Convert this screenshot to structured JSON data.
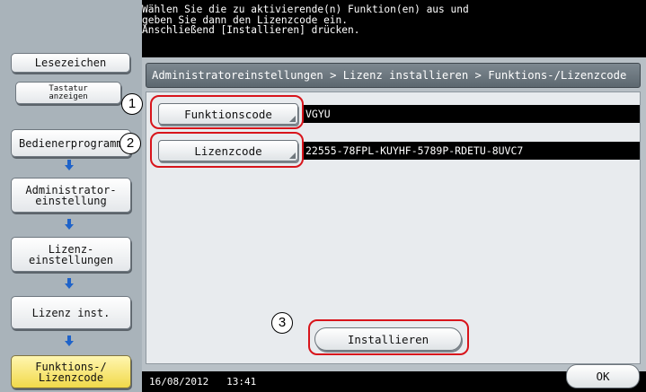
{
  "header": {
    "instruction": "Wählen Sie die zu aktivierende(n) Funktion(en) aus und\ngeben Sie dann den Lizenzcode ein.\nAnschließend [Installieren] drücken."
  },
  "sidebar": {
    "bookmark_label": "Lesezeichen",
    "keyboard_label": "Tastatur\nanzeigen",
    "steps": [
      {
        "label": "Bedienerprogramm"
      },
      {
        "label": "Administrator-\neinstellung"
      },
      {
        "label": "Lizenz-\neinstellungen"
      },
      {
        "label": "Lizenz inst."
      },
      {
        "label": "Funktions-/\nLizenzcode"
      }
    ]
  },
  "breadcrumb": "Administratoreinstellungen > Lizenz installieren > Funktions-/Lizenzcode",
  "fields": {
    "function_code": {
      "label": "Funktionscode",
      "value": "VGYU"
    },
    "license_code": {
      "label": "Lizenzcode",
      "value": "22555-78FPL-KUYHF-5789P-RDETU-8UVC7"
    }
  },
  "callouts": {
    "one": "1",
    "two": "2",
    "three": "3"
  },
  "actions": {
    "install_label": "Installieren",
    "ok_label": "OK"
  },
  "status": {
    "date": "16/08/2012",
    "time": "13:41"
  },
  "colors": {
    "highlight": "#d8141b",
    "arrow": "#1f63c9",
    "active_step": "#f1d94a"
  }
}
